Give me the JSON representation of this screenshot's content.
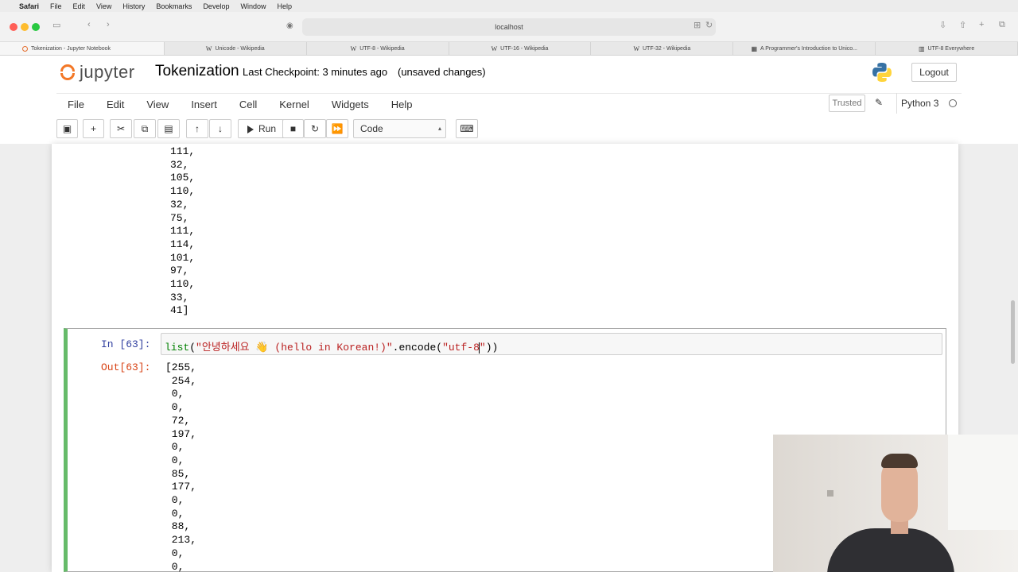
{
  "mac_menu": {
    "app": "Safari",
    "items": [
      "File",
      "Edit",
      "View",
      "History",
      "Bookmarks",
      "Develop",
      "Window",
      "Help"
    ]
  },
  "browser": {
    "address": "localhost",
    "tabs": [
      "Tokenization - Jupyter Notebook",
      "Unicode - Wikipedia",
      "UTF-8 - Wikipedia",
      "UTF-16 - Wikipedia",
      "UTF-32 - Wikipedia",
      "A Programmer's Introduction to Unico...",
      "UTF-8 Everywhere"
    ]
  },
  "header": {
    "logo_text": "jupyter",
    "notebook_title": "Tokenization",
    "checkpoint": "Last Checkpoint: 3 minutes ago",
    "unsaved": "(unsaved changes)",
    "logout": "Logout"
  },
  "menu": {
    "items": [
      "File",
      "Edit",
      "View",
      "Insert",
      "Cell",
      "Kernel",
      "Widgets",
      "Help"
    ],
    "trusted": "Trusted",
    "kernel_name": "Python 3"
  },
  "toolbar": {
    "run_label": "Run",
    "cell_type": "Code"
  },
  "previous_output": {
    "lines": [
      "111,",
      "32,",
      "105,",
      "110,",
      "32,",
      "75,",
      "111,",
      "114,",
      "101,",
      "97,",
      "110,",
      "33,",
      "41]"
    ]
  },
  "cell": {
    "in_prompt": "In [63]:",
    "code_fn": "list",
    "code_open": "(",
    "code_string": "\"안녕하세요 👋 (hello in Korean!)\"",
    "code_method": ".encode(",
    "code_arg": "\"utf-8",
    "code_arg_end": "\"",
    "code_close": "))",
    "out_prompt": "Out[63]:",
    "output_lines": [
      "[255,",
      " 254,",
      " 0,",
      " 0,",
      " 72,",
      " 197,",
      " 0,",
      " 0,",
      " 85,",
      " 177,",
      " 0,",
      " 0,",
      " 88,",
      " 213,",
      " 0,",
      " 0,"
    ]
  },
  "colors": {
    "accent_green": "#66bb6a",
    "in_prompt": "#303f9f",
    "out_prompt": "#d84315",
    "jupyter_orange": "#f37726"
  }
}
